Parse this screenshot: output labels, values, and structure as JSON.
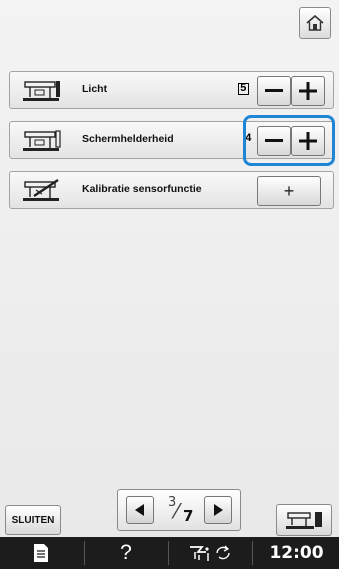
{
  "header": {
    "home_icon": "home-icon"
  },
  "settings": [
    {
      "label": "Licht",
      "value": "5",
      "icon": "sewing-machine-light-icon"
    },
    {
      "label": "Schermhelderheid",
      "value": "4",
      "icon": "sewing-machine-screen-icon"
    },
    {
      "label": "Kalibratie sensorfunctie",
      "icon": "sensor-pen-machine-icon",
      "button_label": "+"
    }
  ],
  "controls": {
    "minus_icon": "minus-icon",
    "plus_icon": "plus-icon"
  },
  "footer": {
    "close_label": "SLUITEN",
    "page_current": "3",
    "page_total": "7",
    "prev_icon": "arrow-left-icon",
    "next_icon": "arrow-right-icon",
    "mode_icon": "machine-mode-icon"
  },
  "taskbar": {
    "doc_icon": "document-icon",
    "help_label": "?",
    "status_icon": "presser-foot-rotate-icon",
    "clock": "12:00"
  },
  "colors": {
    "highlight": "#1f86d6",
    "taskbar": "#1c1c1c"
  }
}
